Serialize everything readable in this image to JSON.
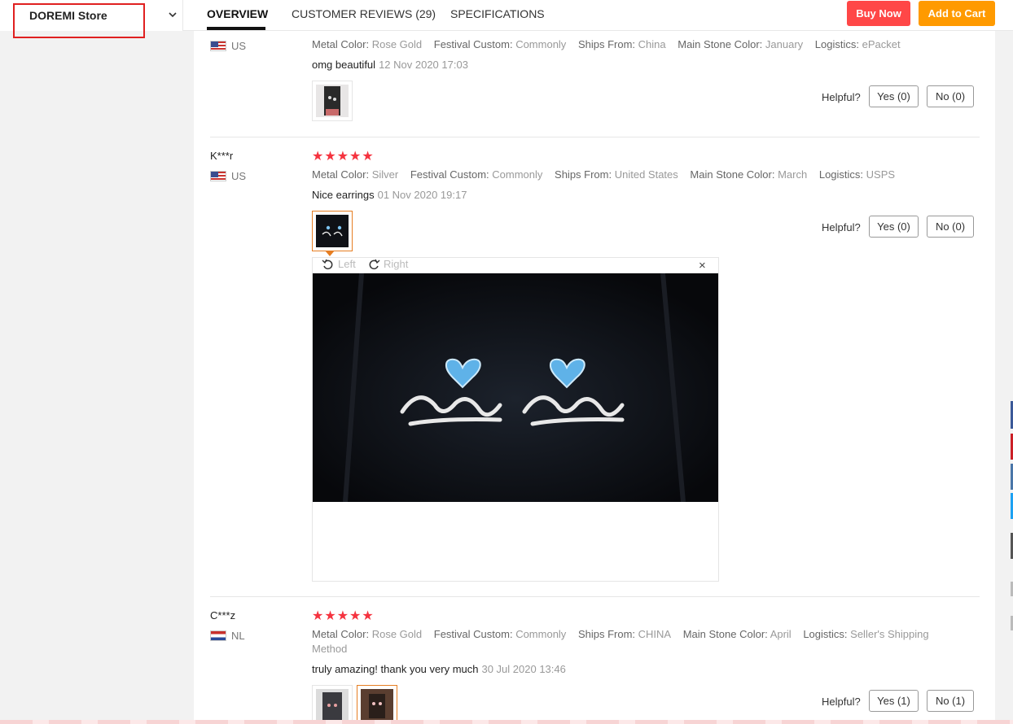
{
  "store": {
    "name": "DOREMI Store"
  },
  "tabs": [
    {
      "label": "OVERVIEW"
    },
    {
      "label": "CUSTOMER REVIEWS (29)"
    },
    {
      "label": "SPECIFICATIONS"
    }
  ],
  "actions": {
    "buy_now": "Buy Now",
    "add_to_cart": "Add to Cart"
  },
  "labels": {
    "metal_color": "Metal Color:",
    "festival_custom": "Festival Custom:",
    "ships_from": "Ships From:",
    "main_stone_color": "Main Stone Color:",
    "logistics": "Logistics:",
    "helpful": "Helpful?"
  },
  "reviews": [
    {
      "country": "US",
      "metal_color": "Rose Gold",
      "festival_custom": "Commonly",
      "ships_from": "China",
      "main_stone_color": "January",
      "logistics": "ePacket",
      "comment": "omg beautiful",
      "date": "12 Nov 2020 17:03",
      "yes": "Yes (0)",
      "no": "No (0)"
    },
    {
      "name": "K***r",
      "country": "US",
      "rating": 5,
      "metal_color": "Silver",
      "festival_custom": "Commonly",
      "ships_from": "United States",
      "main_stone_color": "March",
      "logistics": "USPS",
      "comment": "Nice earrings",
      "date": "01 Nov 2020 19:17",
      "yes": "Yes (0)",
      "no": "No (0)"
    },
    {
      "name": "C***z",
      "country": "NL",
      "rating": 5,
      "metal_color": "Rose Gold",
      "festival_custom": "Commonly",
      "ships_from": "CHINA",
      "main_stone_color": "April",
      "logistics": "Seller's Shipping",
      "logistics_line2": "Method",
      "comment": "truly amazing! thank you very much",
      "date": "30 Jul 2020 13:46",
      "yes": "Yes (1)",
      "no": "No (1)"
    }
  ],
  "viewer": {
    "rotate_left": "Left",
    "rotate_right": "Right",
    "close": "×"
  },
  "icons": {
    "rating": "star-icon",
    "rotate_left": "rotate-left-icon",
    "rotate_right": "rotate-right-icon",
    "close": "close-icon",
    "store_menu": "chevron-down-icon"
  },
  "colors": {
    "buy_now": "#ff4747",
    "add_to_cart": "#ff9a00",
    "stars": "#f5333f",
    "selected_thumb": "#e67e22"
  }
}
